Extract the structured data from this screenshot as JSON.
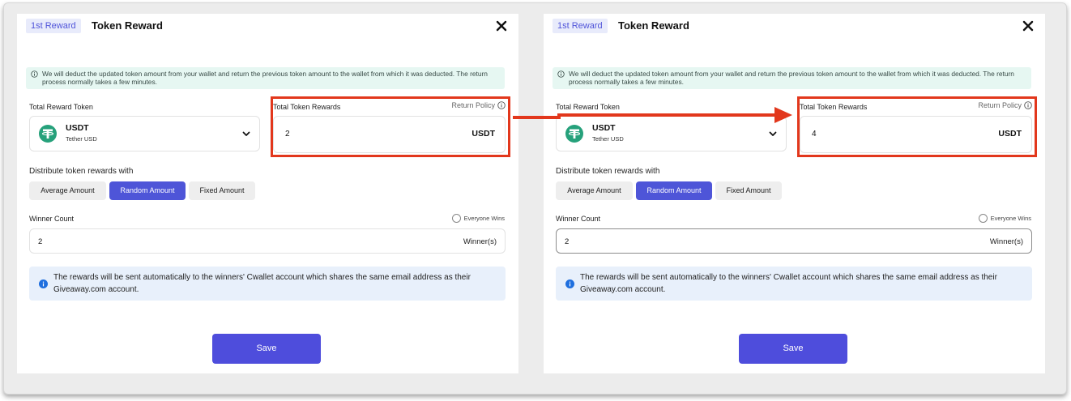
{
  "panels": [
    {
      "badge": "1st Reward",
      "title": "Token Reward",
      "notice": "We will deduct the updated token amount from your wallet and return the previous token amount to the wallet from which it was deducted. The return process normally takes a few minutes.",
      "total_reward_token_label": "Total Reward Token",
      "token_symbol": "USDT",
      "token_name": "Tether USD",
      "total_token_rewards_label": "Total Token Rewards",
      "return_policy_label": "Return Policy",
      "amount_value": "2",
      "amount_unit": "USDT",
      "distribute_label": "Distribute token rewards with",
      "distribution_options": [
        "Average Amount",
        "Random Amount",
        "Fixed Amount"
      ],
      "selected_option": "Random Amount",
      "winner_count_label": "Winner Count",
      "everyone_wins_label": "Everyone Wins",
      "winner_value": "2",
      "winner_unit": "Winner(s)",
      "info_text": "The rewards will be sent automatically to the winners' Cwallet account which shares the same email address as their Giveaway.com account.",
      "save_label": "Save"
    },
    {
      "badge": "1st Reward",
      "title": "Token Reward",
      "notice": "We will deduct the updated token amount from your wallet and return the previous token amount to the wallet from which it was deducted. The return process normally takes a few minutes.",
      "total_reward_token_label": "Total Reward Token",
      "token_symbol": "USDT",
      "token_name": "Tether USD",
      "total_token_rewards_label": "Total Token Rewards",
      "return_policy_label": "Return Policy",
      "amount_value": "4",
      "amount_unit": "USDT",
      "distribute_label": "Distribute token rewards with",
      "distribution_options": [
        "Average Amount",
        "Random Amount",
        "Fixed Amount"
      ],
      "selected_option": "Random Amount",
      "winner_count_label": "Winner Count",
      "everyone_wins_label": "Everyone Wins",
      "winner_value": "2",
      "winner_unit": "Winner(s)",
      "info_text": "The rewards will be sent automatically to the winners' Cwallet account which shares the same email address as their Giveaway.com account.",
      "save_label": "Save"
    }
  ],
  "icons": {
    "close": "close-icon",
    "notice": "info-outline-icon",
    "token_logo": "tether-logo-icon",
    "dropdown": "chevron-down-icon",
    "policy": "info-outline-icon",
    "radio": "radio-unchecked-icon",
    "info": "info-filled-icon",
    "arrow": "arrow-right-icon"
  },
  "colors": {
    "accent": "#4e55d8",
    "highlight": "#e2371c",
    "tether_green": "#26a17b",
    "notice_bg": "#e6f7f2",
    "info_bg": "#e8f0fb"
  }
}
